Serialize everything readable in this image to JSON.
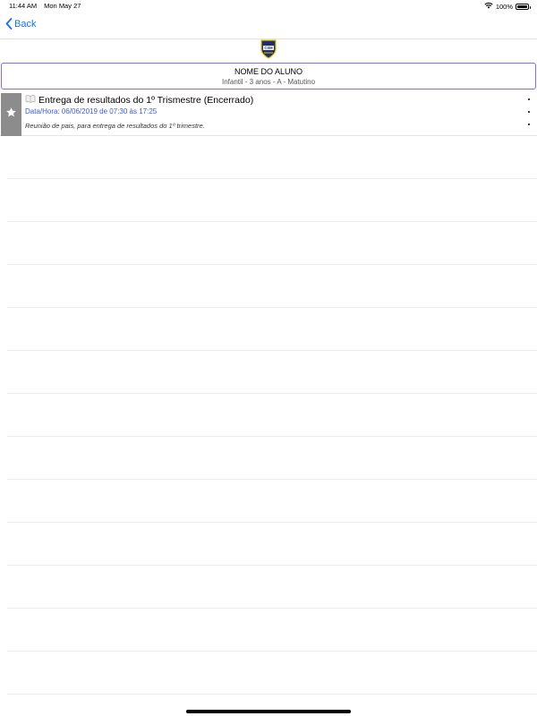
{
  "status_bar": {
    "time": "11:44 AM",
    "date": "Mon May 27",
    "battery": "100%",
    "battery_level": 1.0,
    "icons": [
      "wifi-icon",
      "battery-icon"
    ]
  },
  "nav": {
    "back_label": "Back",
    "back_icon": "chevron-left-icon"
  },
  "logo": {
    "text": "CSM",
    "colors": {
      "shield": "#1f2f6b",
      "accent": "#e6c200"
    }
  },
  "student": {
    "name": "NOME DO ALUNO",
    "class_info": "Infantil - 3 anos - A - Matutino"
  },
  "events": [
    {
      "icon": "book-icon",
      "title": "Entrega de resultados do 1º Trismestre (Encerrado)",
      "datetime": "Data/Hora: 06/06/2019 de 07:30 às 17:25",
      "description": "Reunião de pais, para entrega de resultados do 1º trimestre.",
      "favorite_icon": "star-icon"
    }
  ],
  "colors": {
    "accent": "#1a73e8",
    "card_border": "#7b74d6",
    "star_bg": "#8c8c8c",
    "datetime_text": "#3a5bd9"
  }
}
